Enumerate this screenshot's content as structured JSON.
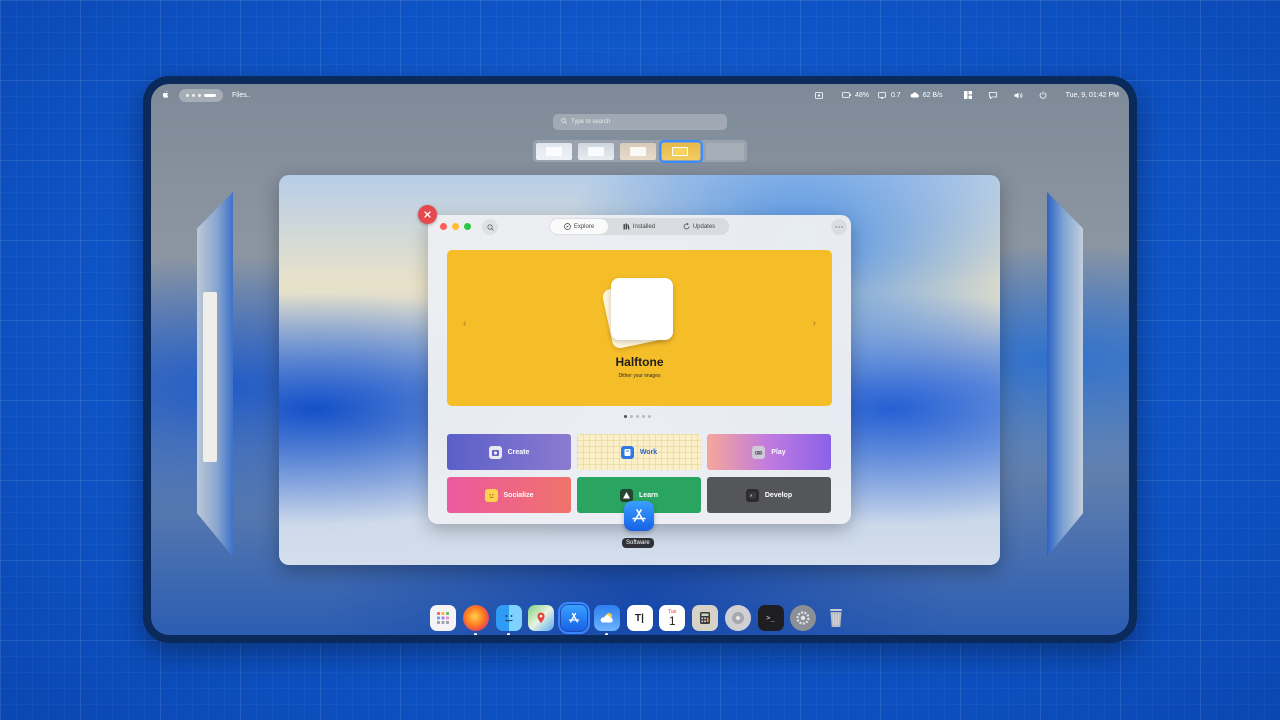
{
  "topbar": {
    "app_label": "Files..",
    "battery": "48%",
    "cpu": "0.7",
    "network": "62 B/s",
    "clock": "Tue, 9, 01:42 PM"
  },
  "overview": {
    "search_placeholder": "Type to search"
  },
  "app_window": {
    "tabs": [
      {
        "label": "Explore",
        "icon": "compass-icon"
      },
      {
        "label": "Installed",
        "icon": "installed-icon"
      },
      {
        "label": "Updates",
        "icon": "refresh-icon"
      }
    ],
    "banner": {
      "title": "Halftone",
      "subtitle": "Dither your images"
    },
    "categories": [
      {
        "label": "Create"
      },
      {
        "label": "Work"
      },
      {
        "label": "Play"
      },
      {
        "label": "Socialize"
      },
      {
        "label": "Learn"
      },
      {
        "label": "Develop"
      }
    ]
  },
  "dock": {
    "hover_label": "Software",
    "calendar_month": "Tue",
    "calendar_day": "1"
  },
  "colors": {
    "accent": "#3c86ff",
    "banner": "#f5be29",
    "close": "#e5484d"
  }
}
